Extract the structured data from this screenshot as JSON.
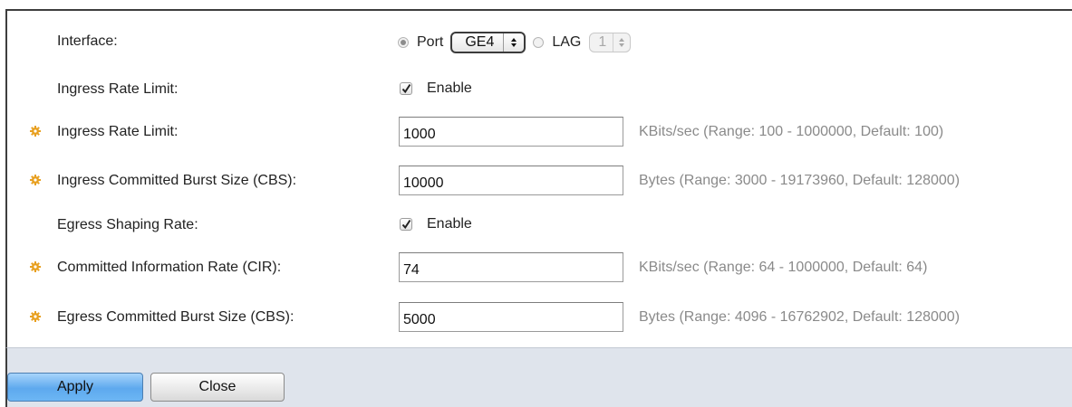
{
  "form": {
    "interface": {
      "label": "Interface:",
      "port_option_label": "Port",
      "port_selected": "GE4",
      "lag_option_label": "LAG",
      "lag_selected": "1",
      "selected_option": "Port"
    },
    "ingress_enable": {
      "label": "Ingress Rate Limit:",
      "checkbox_label": "Enable",
      "checked": true
    },
    "ingress_rate_limit": {
      "label": "Ingress Rate Limit:",
      "value": "1000",
      "hint": "KBits/sec (Range: 100 - 1000000, Default: 100)"
    },
    "ingress_cbs": {
      "label": "Ingress Committed Burst Size (CBS):",
      "value": "10000",
      "hint": "Bytes (Range: 3000 - 19173960, Default: 128000)"
    },
    "egress_enable": {
      "label": "Egress Shaping Rate:",
      "checkbox_label": "Enable",
      "checked": true
    },
    "cir": {
      "label": "Committed Information Rate (CIR):",
      "value": "74",
      "hint": "KBits/sec (Range: 64 - 1000000, Default: 64)"
    },
    "egress_cbs": {
      "label": "Egress Committed Burst Size (CBS):",
      "value": "5000",
      "hint": "Bytes (Range: 4096 - 16762902, Default: 128000)"
    }
  },
  "buttons": {
    "apply_label": "Apply",
    "close_label": "Close"
  },
  "icons": {
    "required": "required-gear-icon",
    "select_arrows": "updown-arrows-icon",
    "checkmark": "checkmark-icon"
  },
  "colors": {
    "required_icon": "#e8a020",
    "hint_text": "#8a8a8a",
    "apply_button": "#5ea9ee",
    "footer_bg": "#dfe4ec"
  }
}
